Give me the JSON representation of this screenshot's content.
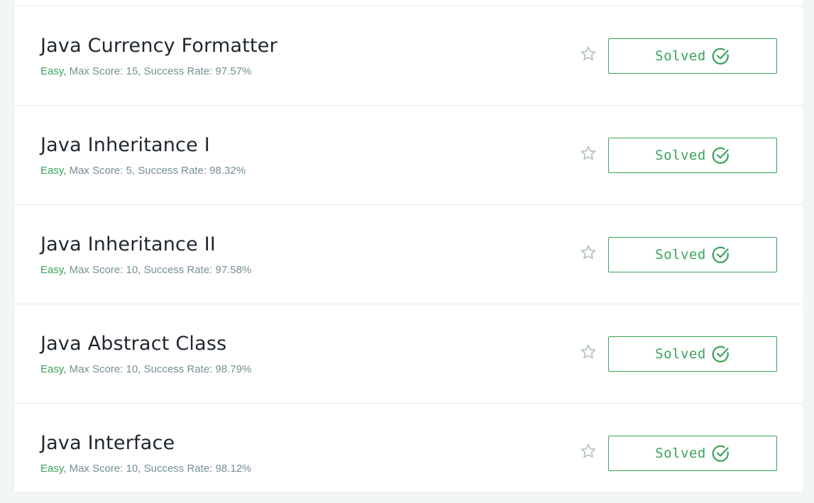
{
  "challenges": [
    {
      "title": "Java Currency Formatter",
      "difficulty": "Easy,",
      "details": " Max Score: 15, Success Rate: 97.57%",
      "status_label": "Solved"
    },
    {
      "title": "Java Inheritance I",
      "difficulty": "Easy,",
      "details": " Max Score: 5, Success Rate: 98.32%",
      "status_label": "Solved"
    },
    {
      "title": "Java Inheritance II",
      "difficulty": "Easy,",
      "details": " Max Score: 10, Success Rate: 97.58%",
      "status_label": "Solved"
    },
    {
      "title": "Java Abstract Class",
      "difficulty": "Easy,",
      "details": " Max Score: 10, Success Rate: 98.79%",
      "status_label": "Solved"
    },
    {
      "title": "Java Interface",
      "difficulty": "Easy,",
      "details": " Max Score: 10, Success Rate: 98.12%",
      "status_label": "Solved"
    }
  ],
  "icons": {
    "bookmark": "star-icon",
    "status": "check-circle-icon"
  },
  "colors": {
    "accent_green": "#39a35a",
    "meta_gray": "#738f93",
    "title_dark": "#1f262e",
    "star_gray": "#b7c4c6",
    "page_background": "#f3f6f6"
  }
}
